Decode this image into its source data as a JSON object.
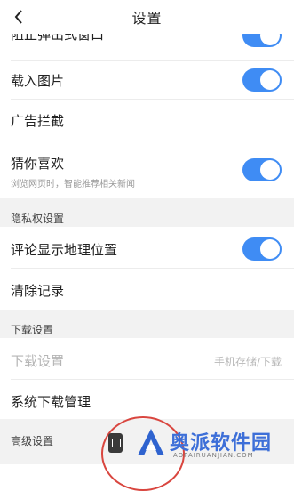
{
  "header": {
    "title": "设置"
  },
  "settings": {
    "block_popups": {
      "label": "阻止弹出式窗口",
      "on": true
    },
    "load_images": {
      "label": "载入图片",
      "on": true
    },
    "ad_block": {
      "label": "广告拦截"
    },
    "recommend": {
      "label": "猜你喜欢",
      "sub": "浏览网页时，智能推荐相关新闻",
      "on": true
    }
  },
  "privacy": {
    "section_label": "隐私权设置",
    "show_location": {
      "label": "评论显示地理位置",
      "on": true
    },
    "clear_records": {
      "label": "清除记录"
    }
  },
  "download": {
    "section_label": "下载设置",
    "download_settings": {
      "label": "下载设置",
      "value": "手机存储/下载"
    },
    "system_download": {
      "label": "系统下载管理"
    }
  },
  "advanced": {
    "section_label": "高级设置"
  },
  "watermark": {
    "brand": "奥派软件园",
    "url": "AOPAIRUANJIAN.COM"
  },
  "colors": {
    "accent": "#3f8cf4",
    "highlight": "#d9463f"
  }
}
